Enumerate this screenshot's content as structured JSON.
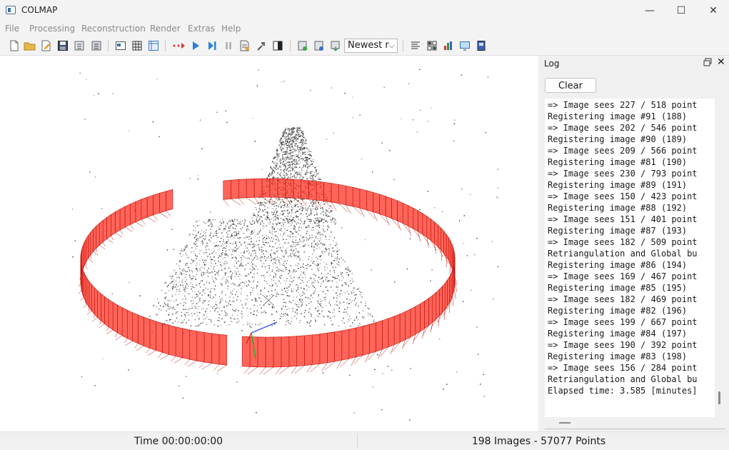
{
  "window": {
    "title": "COLMAP",
    "minimize": "—",
    "maximize": "☐",
    "close": "✕"
  },
  "menu": [
    "File",
    "Processing",
    "Reconstruction",
    "Render",
    "Extras",
    "Help"
  ],
  "toolbar": {
    "combo_value": "Newest r",
    "icons": [
      "new-project-icon",
      "open-project-icon",
      "edit-project-icon",
      "save-project-icon",
      "import-model-icon",
      "export-model-icon",
      "feature-extraction-icon",
      "feature-matching-icon",
      "database-icon",
      "automatic-reconstruction-icon",
      "start-reconstruction-icon",
      "step-reconstruction-icon",
      "pause-reconstruction-icon",
      "bundle-adjustment-icon",
      "reconstruction-options-icon",
      "render-options-icon",
      "add-model-icon",
      "delete-model-icon",
      "export-points-icon",
      "show-log-icon",
      "match-matrix-icon",
      "statistics-icon",
      "grab-image-icon",
      "grab-movie-icon"
    ]
  },
  "viewport": {
    "label": "3D reconstruction view",
    "camera_color": "#ff2a1a"
  },
  "log": {
    "title": "Log",
    "clear_label": "Clear",
    "lines": [
      "=> Image sees 227 / 518 point",
      "Registering image #91 (188)",
      "=> Image sees 202 / 546 point",
      "Registering image #90 (189)",
      "=> Image sees 209 / 566 point",
      "Registering image #81 (190)",
      "=> Image sees 230 / 793 point",
      "Registering image #89 (191)",
      "=> Image sees 150 / 423 point",
      "Registering image #88 (192)",
      "=> Image sees 151 / 401 point",
      "Registering image #87 (193)",
      "=> Image sees 182 / 509 point",
      "Retriangulation and Global bu",
      "Registering image #86 (194)",
      "=> Image sees 169 / 467 point",
      "Registering image #85 (195)",
      "=> Image sees 182 / 469 point",
      "Registering image #82 (196)",
      "=> Image sees 199 / 667 point",
      "Registering image #84 (197)",
      "=> Image sees 190 / 392 point",
      "Registering image #83 (198)",
      "=> Image sees 156 / 284 point",
      "Retriangulation and Global bu",
      "Elapsed time: 3.585 [minutes]"
    ]
  },
  "status": {
    "time": "Time 00:00:00:00",
    "counts": "198 Images - 57077 Points"
  }
}
